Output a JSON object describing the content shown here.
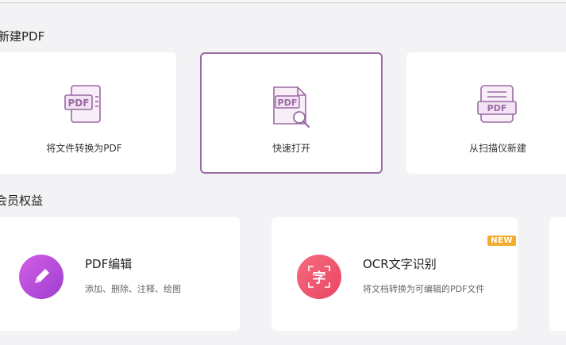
{
  "new_pdf": {
    "title": "新建PDF",
    "cards": [
      {
        "label": "将文件转换为PDF",
        "icon": "file-to-pdf-icon"
      },
      {
        "label": "快速打开",
        "icon": "pdf-search-icon"
      },
      {
        "label": "从扫描仪新建",
        "icon": "scanner-icon"
      }
    ]
  },
  "member": {
    "title": "会员权益",
    "features": [
      {
        "title": "PDF编辑",
        "desc": "添加、删除、注释、绘图",
        "icon": "edit-pencil-icon",
        "color": "#b34fd8"
      },
      {
        "title": "OCR文字识别",
        "desc": "将文档转换为可编辑的PDF文件",
        "icon": "ocr-char-icon",
        "icon_text": "字",
        "badge": "NEW",
        "color": "#f0506e"
      }
    ]
  },
  "colors": {
    "accent": "#9a6aa3",
    "badge": "#f3ad2e"
  }
}
